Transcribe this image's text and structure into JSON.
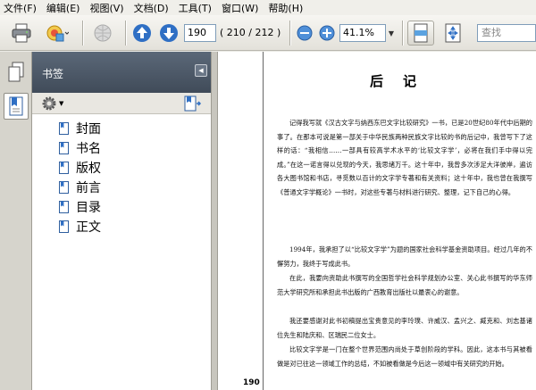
{
  "menu": [
    "文件(F)",
    "编辑(E)",
    "视图(V)",
    "文档(D)",
    "工具(T)",
    "窗口(W)",
    "帮助(H)"
  ],
  "toolbar": {
    "page_value": "190",
    "page_count": "( 210 / 212 )",
    "zoom_value": "41.1%",
    "search_placeholder": "查找"
  },
  "panel": {
    "title": "书签",
    "bookmarks": [
      "封面",
      "书名",
      "版权",
      "前言",
      "目录",
      "正文"
    ]
  },
  "document": {
    "title": "后记",
    "page_number": "190",
    "paragraphs": [
      "记得我写就《汉古文字与纳西东巴文字比较研究》一书，已是20世纪80年代中后期的事了。在那本可说是第一部关于中华民族两种民族文字比较的书的后记中，我曾写下了这样的话：“我相信……一部具有较高学术水平的‘比较文字学’，必将在我们手中得以完成。”在这一诺言得以兑现的今天，我思绪万千。这十年中，我曾多次涉足大洋彼岸，遍访各大图书馆和书店，寻觅数以百计的文字学专著和有关资料；这十年中，我也曾在我撰写《普通文字学概论》一书时，对这些专著与材料进行研究、整理，记下自己的心得。",
      "1994年，我承担了以“比较文字学”为题的国家社会科学基金资助项目。经过几年的不懈努力，我终于写成此书。",
      "在此，我要向资助此书撰写的全国哲学社会科学规划办公室、关心此书撰写的华东师范大学研究所和承担此书出版的广西教育出版社以最衷心的谢意。",
      "我还要感谢对此书初稿提出宝贵意见的李玲璞、许威汉、孟兴之、臧克和、刘志基诸位先生和陆庆和、区瑞民二位女士。",
      "比较文字学是一门在整个世界范围内尚处于草创阶段的学科。因此，这本书与其被看做是对已往这一领域工作的总结，不如被看做是今后这一领域中有关研究的开始。"
    ]
  },
  "colors": {
    "panel_header": "#4c5868",
    "arrow_blue": "#2f6fc4",
    "toolbar_bg": "#ecebe6"
  },
  "icons": {
    "print": "printer-icon",
    "email": "email-icon",
    "collab": "globe-icon",
    "prev": "arrow-up-icon",
    "next": "arrow-down-icon",
    "zoom_out": "zoom-out-icon",
    "zoom_in": "zoom-in-icon",
    "fit_width": "fit-width-icon",
    "fit_page": "fit-page-icon",
    "pages": "pages-icon",
    "bookmarks": "bookmarks-icon",
    "options": "gear-icon",
    "expand": "expand-bookmark-icon",
    "bookmark_item": "bookmark-page-icon"
  }
}
